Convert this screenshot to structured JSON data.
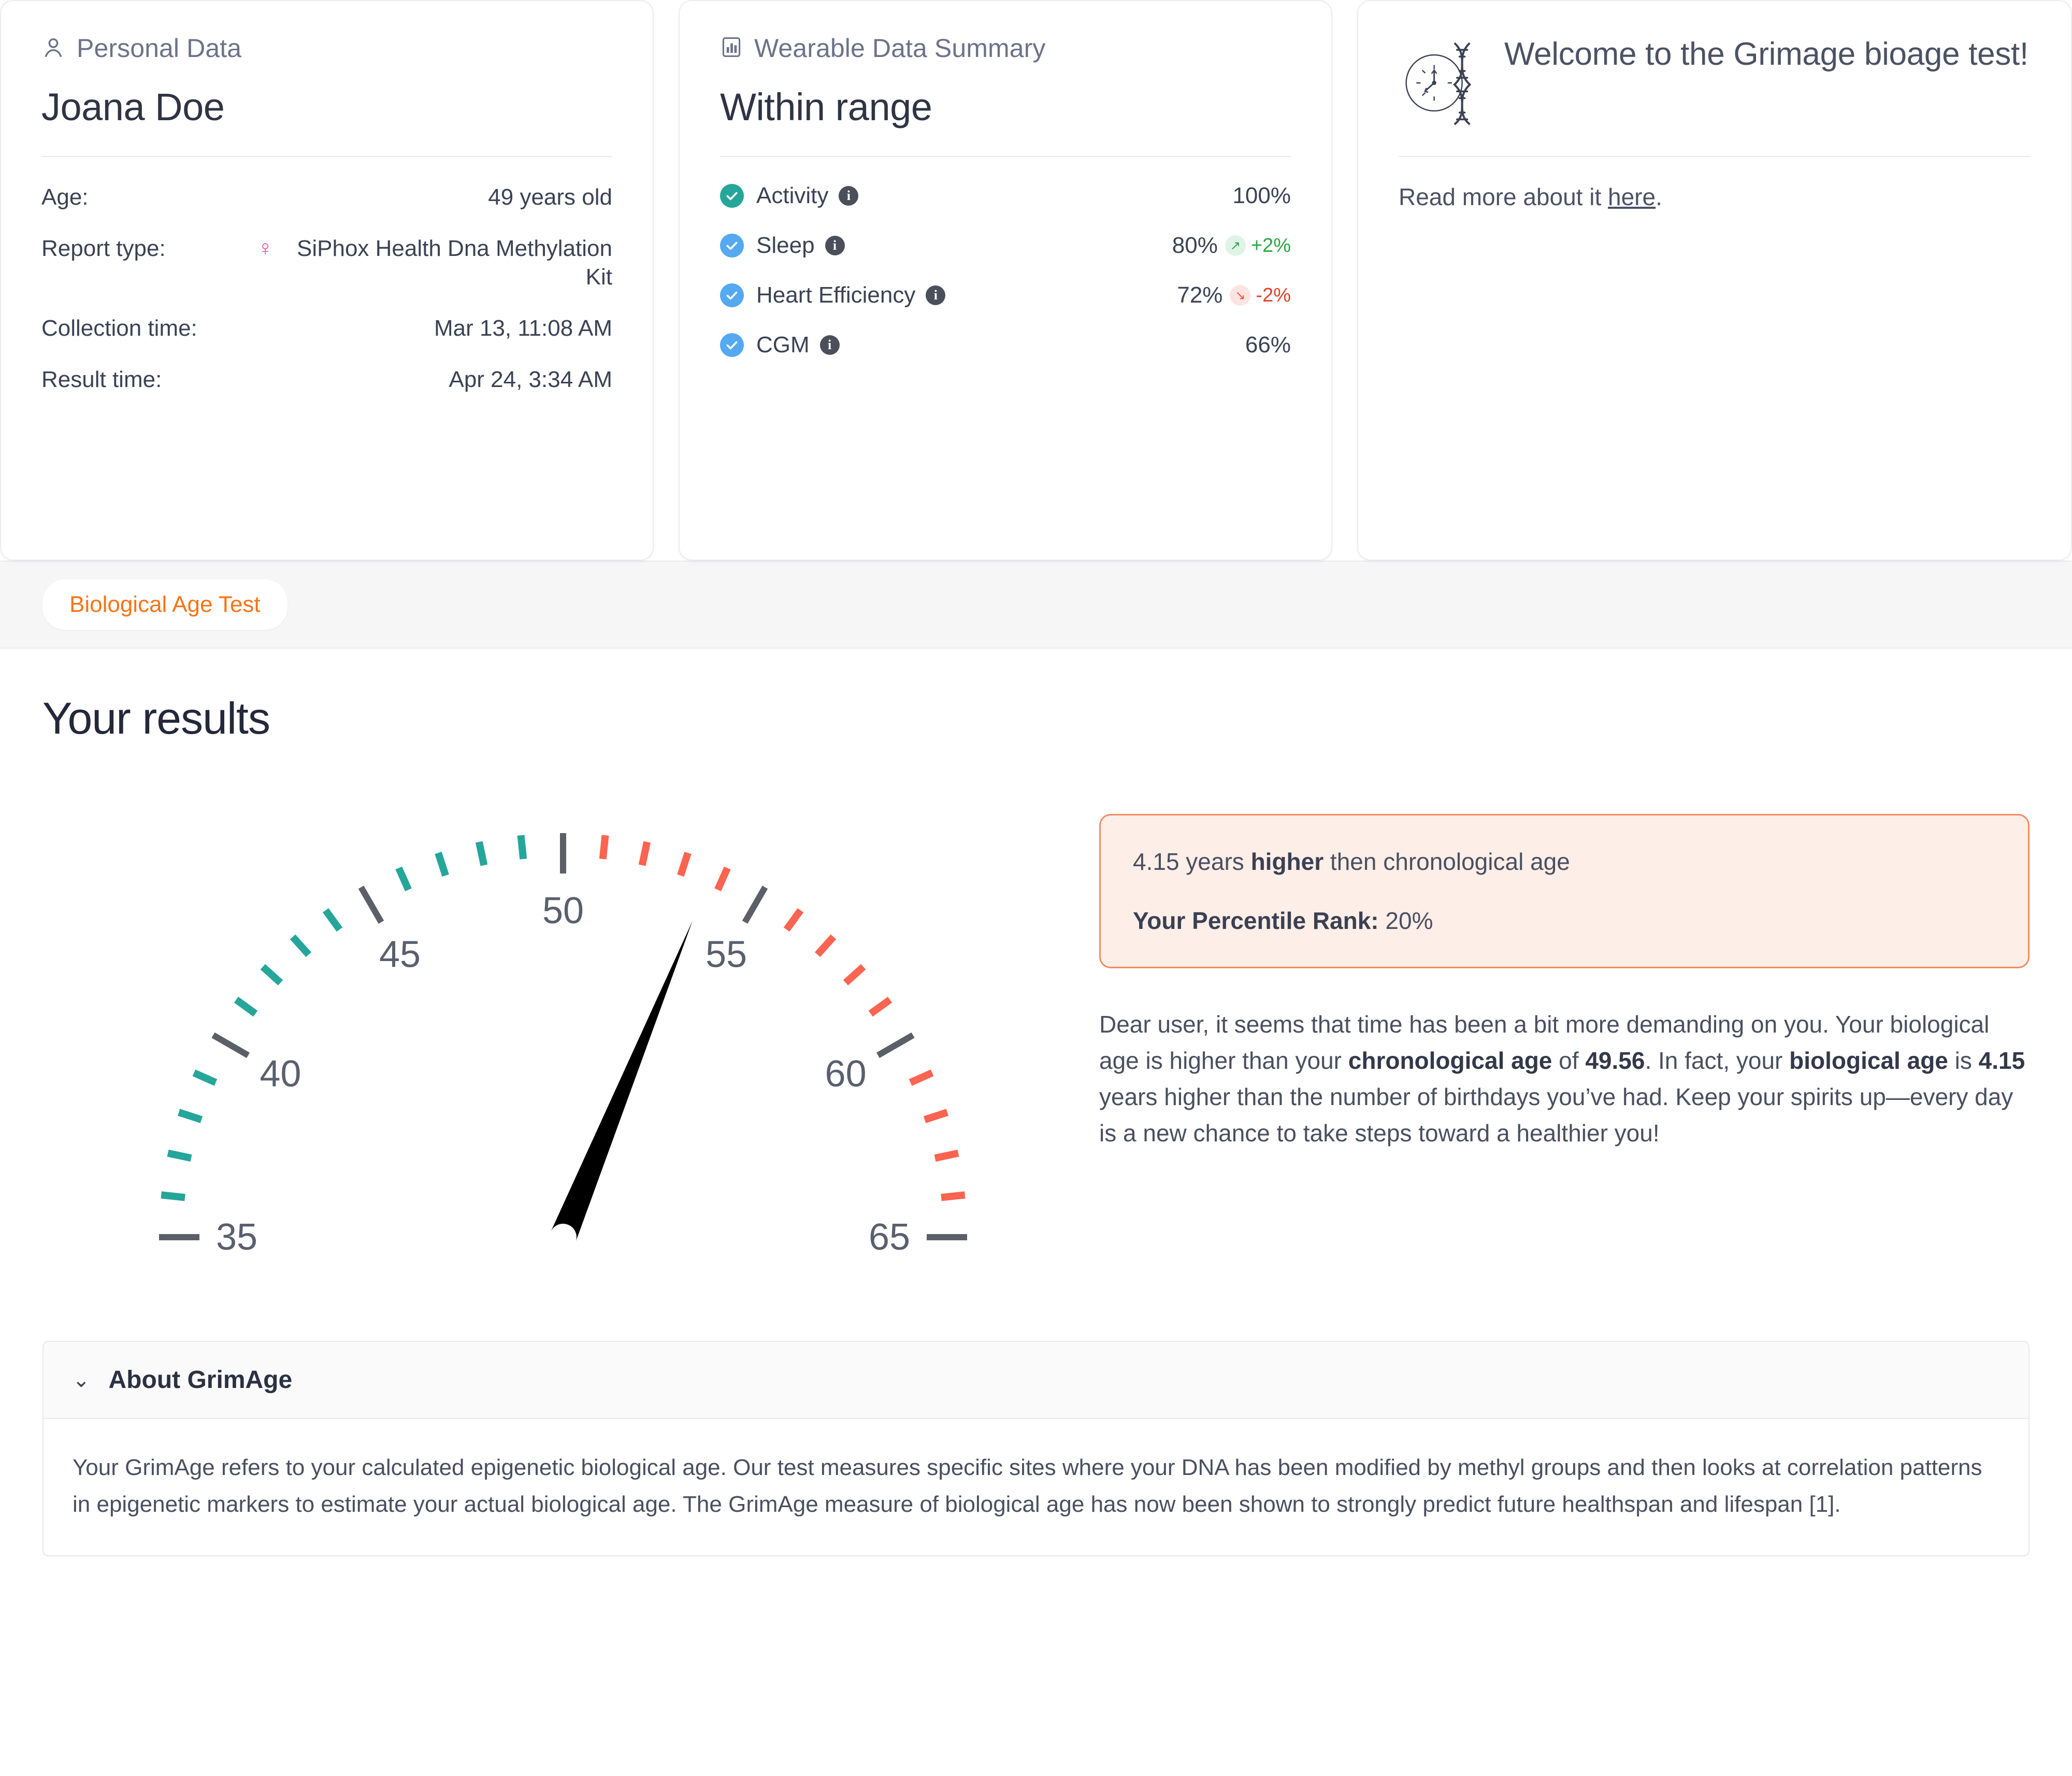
{
  "personal": {
    "header_label": "Personal Data",
    "name": "Joana Doe",
    "rows": [
      {
        "key": "Age:",
        "value": "49 years old",
        "gender_icon": null
      },
      {
        "key": "Report type:",
        "value": "SiPhox Health Dna Methylation Kit",
        "gender_icon": "♀"
      },
      {
        "key": "Collection time:",
        "value": "Mar 13, 11:08 AM",
        "gender_icon": null
      },
      {
        "key": "Result time:",
        "value": "Apr 24, 3:34 AM",
        "gender_icon": null
      }
    ]
  },
  "wearable": {
    "header_label": "Wearable Data Summary",
    "status": "Within range",
    "metrics": [
      {
        "label": "Activity",
        "value": "100%",
        "check_color": "#26a69a",
        "trend": null,
        "info": "i"
      },
      {
        "label": "Sleep",
        "value": "80%",
        "check_color": "#54a9f0",
        "trend": {
          "dir": "up",
          "arrow": "↗",
          "text": "+2%"
        },
        "info": "i"
      },
      {
        "label": "Heart Efficiency",
        "value": "72%",
        "check_color": "#54a9f0",
        "trend": {
          "dir": "down",
          "arrow": "↘",
          "text": "-2%"
        },
        "info": "i"
      },
      {
        "label": "CGM",
        "value": "66%",
        "check_color": "#54a9f0",
        "trend": null,
        "info": "i"
      }
    ]
  },
  "welcome": {
    "title": "Welcome to the Grimage bioage test!",
    "read_more_prefix": "Read more about it ",
    "read_more_link": "here",
    "read_more_suffix": "."
  },
  "tabs": [
    {
      "label": "Biological Age Test",
      "active": true
    }
  ],
  "results": {
    "title": "Your results",
    "callout": {
      "line1_value": "4.15",
      "line1_mid": " years ",
      "line1_bold": "higher",
      "line1_tail": " then chronological age",
      "line2_label": "Your Percentile Rank:",
      "line2_value": "20%"
    },
    "narrative": {
      "part1": "Dear user, it seems that time has been a bit more demanding on you. Your biological age is higher than your ",
      "bold1": "chronological age",
      "part2": " of ",
      "bold2": "49.56",
      "part3": ". In fact, your ",
      "bold3": "biological age",
      "part4": " is ",
      "bold4": "4.15",
      "part5": " years higher than the number of birthdays you’ve had. Keep your spirits up—every day is a new chance to take steps toward a healthier you!"
    }
  },
  "accordion": {
    "chevron": "⌄",
    "title": "About GrimAge",
    "body": "Your GrimAge refers to your calculated epigenetic biological age. Our test measures specific sites where your DNA has been modified by methyl groups and then looks at correlation patterns in epigenetic markers to estimate your actual biological age. The GrimAge measure of biological age has now been shown to strongly predict future healthspan and lifespan [1]."
  },
  "chart_data": {
    "type": "gauge",
    "title": "Biological age gauge",
    "value": 53.71,
    "chronological_age": 49.56,
    "difference": 4.15,
    "percentile_rank": 20,
    "min": 35,
    "max": 65,
    "start_angle_deg": 180,
    "end_angle_deg": 360,
    "major_ticks": [
      35,
      40,
      45,
      50,
      55,
      60,
      65
    ],
    "major_tick_labels": [
      "35",
      "40",
      "45",
      "50",
      "55",
      "60",
      "65"
    ],
    "minor_tick_step": 1,
    "minor_tick_color_low": "#26a69a",
    "minor_tick_color_high": "#fa6450",
    "major_tick_color": "#5b5f68",
    "needle_color": "#000000",
    "color_split_value": 50,
    "label_color": "#5a5f6e"
  },
  "colors": {
    "accent_orange": "#f97316",
    "callout_border": "#f58a63",
    "callout_bg": "#fdeee8",
    "teal": "#26a69a",
    "red": "#fa6450",
    "blue": "#54a9f0",
    "green": "#28a745",
    "pink": "#f0509b"
  }
}
